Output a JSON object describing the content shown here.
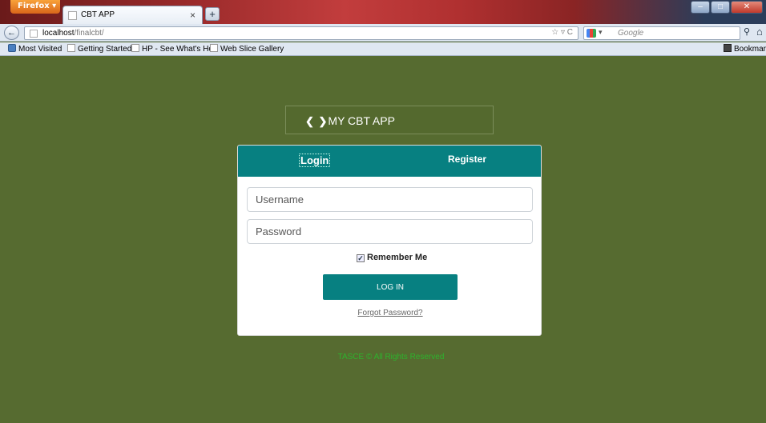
{
  "browser": {
    "menu_button": "Firefox",
    "tab_title": "CBT APP",
    "tab_close": "×",
    "new_tab": "+",
    "url_host": "localhost",
    "url_path": "/finalcbt/",
    "search_placeholder": "Google",
    "bookmarks": [
      "Most Visited",
      "Getting Started",
      "HP - See What's Hot",
      "Web Slice Gallery",
      "Bookmarks"
    ]
  },
  "page": {
    "brand": "MY CBT APP",
    "tabs": {
      "login": "Login",
      "register": "Register"
    },
    "username_placeholder": "Username",
    "password_placeholder": "Password",
    "remember_label": "Remember Me",
    "remember_checked": true,
    "login_button": "LOG IN",
    "forgot_link": "Forgot Password?",
    "footer": "TASCE © All Rights Reserved"
  },
  "colors": {
    "page_bg": "#566b30",
    "accent": "#078081",
    "footer_text": "#2db32d"
  }
}
